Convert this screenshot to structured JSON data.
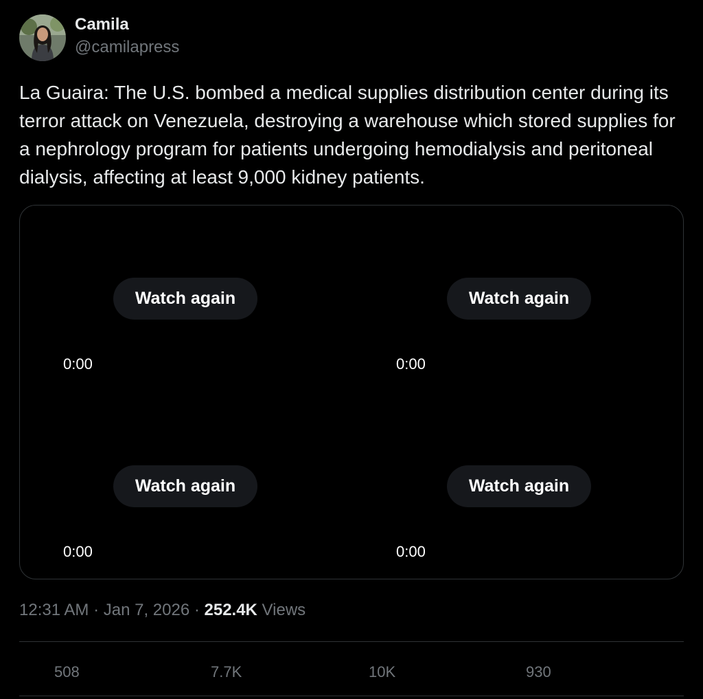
{
  "author": {
    "display_name": "Camila",
    "handle": "@camilapress"
  },
  "tweet": {
    "text": "La Guaira: The U.S. bombed a medical supplies distribution center during its terror attack on Venezuela, destroying a warehouse which stored supplies for a nephrology program for patients undergoing hemodialysis and peritoneal dialysis, affecting at least 9,000 kidney patients."
  },
  "media": {
    "videos": [
      {
        "button_label": "Watch again",
        "time": "0:00"
      },
      {
        "button_label": "Watch again",
        "time": "0:00"
      },
      {
        "button_label": "Watch again",
        "time": "0:00"
      },
      {
        "button_label": "Watch again",
        "time": "0:00"
      }
    ]
  },
  "meta": {
    "time": "12:31 AM",
    "separator1": " · ",
    "date": "Jan 7, 2026",
    "separator2": " · ",
    "views_count": "252.4K",
    "views_label": " Views"
  },
  "actions": [
    {
      "name": "reply",
      "count": "508"
    },
    {
      "name": "repost",
      "count": "7.7K"
    },
    {
      "name": "like",
      "count": "10K"
    },
    {
      "name": "bookmark",
      "count": "930"
    }
  ],
  "colors": {
    "background": "#000000",
    "text_primary": "#e7e9ea",
    "text_secondary": "#71767b",
    "border": "#2f3336",
    "button_bg": "#16181c"
  }
}
